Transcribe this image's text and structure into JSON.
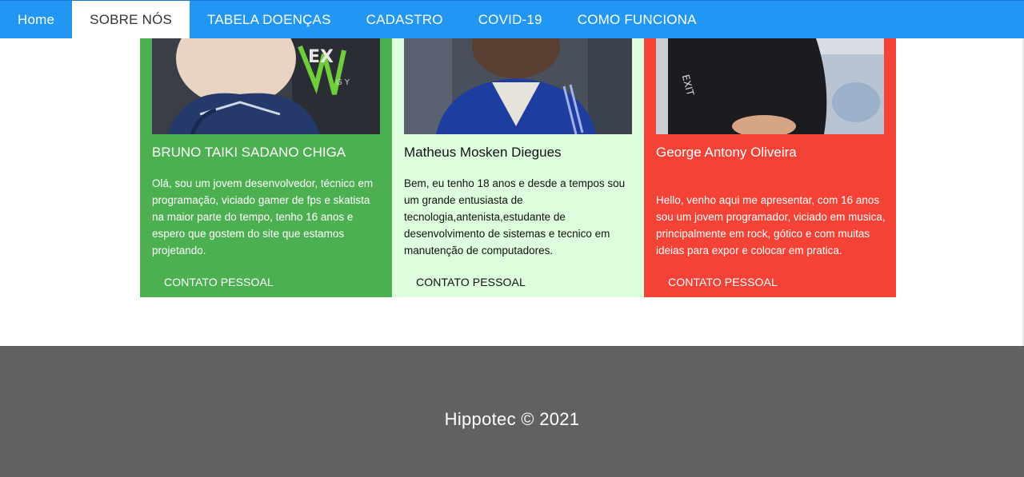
{
  "nav": {
    "items": [
      {
        "label": "Home",
        "active": false
      },
      {
        "label": "SOBRE NÓS",
        "active": true
      },
      {
        "label": "TABELA DOENÇAS",
        "active": false
      },
      {
        "label": "CADASTRO",
        "active": false
      },
      {
        "label": "COVID-19",
        "active": false
      },
      {
        "label": "COMO FUNCIONA",
        "active": false
      }
    ]
  },
  "cards": [
    {
      "name": "BRUNO TAIKI SADANO CHIGA",
      "description": "Olá, sou um jovem desenvolvedor, técnico em programação, viciado gamer de fps e skatista na maior parte do tempo, tenho 16 anos e espero que gostem do site que estamos projetando.",
      "contact_label": "CONTATO PESSOAL",
      "background_color": "#4caf50"
    },
    {
      "name": "Matheus Mosken Diegues",
      "description": "Bem, eu tenho 18 anos e desde a tempos sou um grande entusiasta de tecnologia,antenista,estudante de desenvolvimento de sistemas e tecnico em manutenção de computadores.",
      "contact_label": "CONTATO PESSOAL",
      "background_color": "#ddffdd"
    },
    {
      "name": "George Antony Oliveira",
      "description": "Hello, venho aqui me apresentar, com 16 anos sou um jovem programador, viciado em musica, principalmente em rock, gótico e com muitas ideias para expor e colocar em pratica.",
      "contact_label": "CONTATO PESSOAL",
      "background_color": "#f44336"
    }
  ],
  "footer": {
    "text": "Hippotec © 2021"
  },
  "colors": {
    "nav_background": "#2196f3",
    "footer_background": "#616161"
  }
}
